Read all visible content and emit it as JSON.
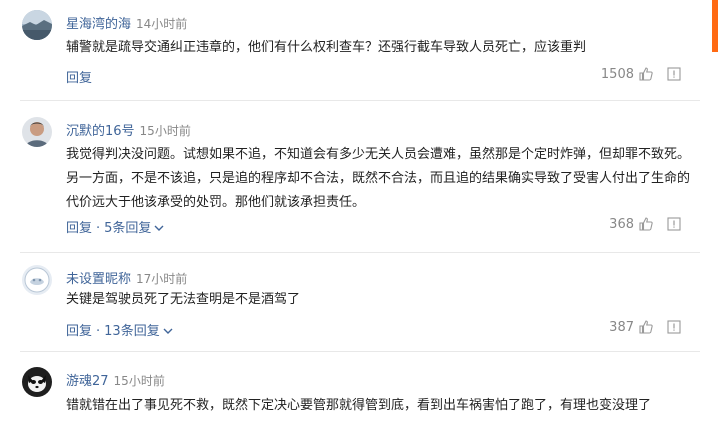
{
  "comments": [
    {
      "username": "星海湾的海",
      "time": "14小时前",
      "text": "辅警就是疏导交通纠正违章的，他们有什么权利查车？还强行截车导致人员死亡，应该重判",
      "reply_label": "回复",
      "more_replies": "",
      "likes": "1508",
      "avatar": "landscape"
    },
    {
      "username": "沉默的16号",
      "time": "15小时前",
      "text": "我觉得判决没问题。试想如果不追，不知道会有多少无关人员会遭难，虽然那是个定时炸弹，但却罪不致死。另一方面，不是不该追，只是追的程序却不合法，既然不合法，而且追的结果确实导致了受害人付出了生命的代价远大于他该承受的处罚。那他们就该承担责任。",
      "reply_label": "回复",
      "more_replies": "5条回复",
      "likes": "368",
      "avatar": "person"
    },
    {
      "username": "未设置昵称",
      "time": "17小时前",
      "text": "关键是驾驶员死了无法查明是不是酒驾了",
      "reply_label": "回复",
      "more_replies": "13条回复",
      "likes": "387",
      "avatar": "default"
    },
    {
      "username": "游魂27",
      "time": "15小时前",
      "text": "错就错在出了事见死不救，既然下定决心要管那就得管到底，看到出车祸害怕了跑了，有理也变没理了",
      "reply_label": "",
      "more_replies": "",
      "likes": "",
      "avatar": "dog"
    }
  ],
  "icons": {
    "like": "thumbs-up-icon",
    "report": "report-icon",
    "expand": "chevron-down-icon"
  },
  "colors": {
    "username": "#406599",
    "meta": "#888888",
    "accent": "#ff6a13"
  }
}
